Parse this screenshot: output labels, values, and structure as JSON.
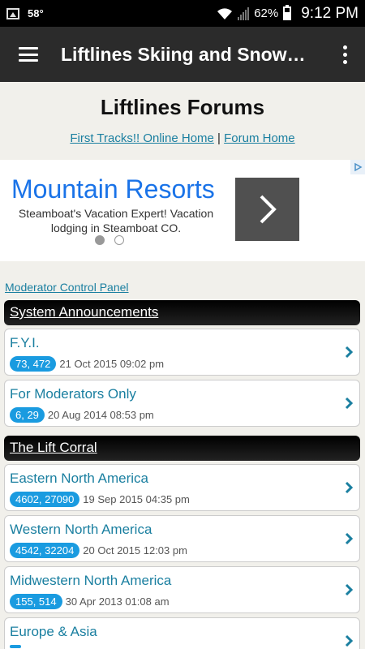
{
  "status": {
    "temperature": "58°",
    "battery": "62%",
    "time": "9:12 PM"
  },
  "appbar": {
    "title": "Liftlines Skiing and Snowboarding"
  },
  "header": {
    "title": "Liftlines Forums",
    "link_home": "First Tracks!! Online Home",
    "separator": "|",
    "link_forum_home": "Forum Home"
  },
  "ad": {
    "title": "Mountain Resorts",
    "text": "Steamboat's Vacation Expert! Vacation lodging in Steamboat CO."
  },
  "content": {
    "mod_link": "Moderator Control Panel",
    "categories": [
      {
        "title": "System Announcements",
        "forums": [
          {
            "name": "F.Y.I.",
            "counts": "73, 472",
            "date": "21 Oct 2015 09:02 pm"
          },
          {
            "name": "For Moderators Only",
            "counts": "6, 29",
            "date": "20 Aug 2014 08:53 pm"
          }
        ]
      },
      {
        "title": "The Lift Corral",
        "forums": [
          {
            "name": "Eastern North America",
            "counts": "4602, 27090",
            "date": "19 Sep 2015 04:35 pm"
          },
          {
            "name": "Western North America",
            "counts": "4542, 32204",
            "date": "20 Oct 2015 12:03 pm"
          },
          {
            "name": "Midwestern North America",
            "counts": "155, 514",
            "date": "30 Apr 2013 01:08 am"
          },
          {
            "name": "Europe & Asia",
            "counts": "",
            "date": ""
          }
        ]
      }
    ]
  },
  "colors": {
    "link": "#1a7fa0",
    "badge": "#1a9be0",
    "ad_title": "#1a73e8"
  }
}
